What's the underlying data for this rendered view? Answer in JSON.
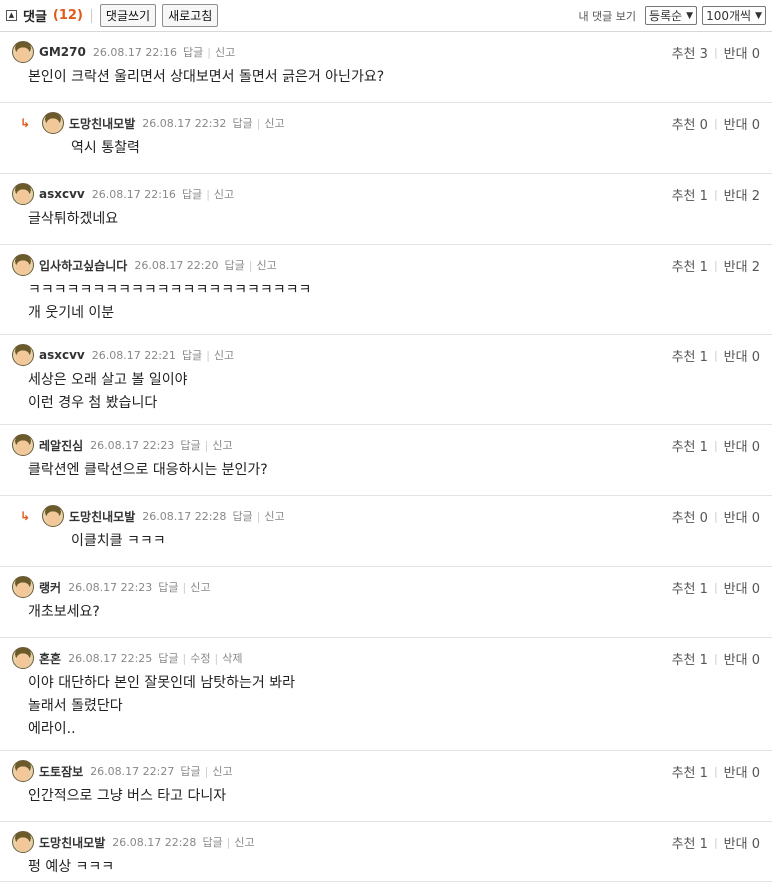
{
  "header": {
    "title": "댓글",
    "count": "(12)",
    "write_button": "댓글쓰기",
    "refresh_button": "새로고침",
    "my_comments": "내 댓글 보기",
    "sort_value": "등록순",
    "per_page_value": "100개씩"
  },
  "labels": {
    "reply": "답글",
    "report": "신고",
    "edit": "수정",
    "delete": "삭제",
    "recommend": "추천",
    "oppose": "반대",
    "reply_arrow": "↳"
  },
  "comments": [
    {
      "nick": "GM270",
      "date": "26.08.17 22:16",
      "up": "3",
      "down": "0",
      "lines": [
        "본인이 크락션 울리면서 상대보면서 돌면서 긁은거 아닌가요?"
      ]
    },
    {
      "nick": "도망친내모발",
      "date": "26.08.17 22:32",
      "up": "0",
      "down": "0",
      "lines": [
        "역시 통찰력"
      ]
    },
    {
      "nick": "asxcvv",
      "date": "26.08.17 22:16",
      "up": "1",
      "down": "2",
      "lines": [
        "글삭튀하겠네요"
      ]
    },
    {
      "nick": "입사하고싶습니다",
      "date": "26.08.17 22:20",
      "up": "1",
      "down": "2",
      "lines": [
        "ㅋㅋㅋㅋㅋㅋㅋㅋㅋㅋㅋㅋㅋㅋㅋㅋㅋㅋㅋㅋㅋㅋ",
        "개 웃기네 이분"
      ]
    },
    {
      "nick": "asxcvv",
      "date": "26.08.17 22:21",
      "up": "1",
      "down": "0",
      "lines": [
        "세상은 오래 살고 볼 일이야",
        "이런 경우 첨 봤습니다"
      ]
    },
    {
      "nick": "레알진심",
      "date": "26.08.17 22:23",
      "up": "1",
      "down": "0",
      "lines": [
        "클락션엔 클락션으로 대응하시는 분인가?"
      ]
    },
    {
      "nick": "도망친내모발",
      "date": "26.08.17 22:28",
      "up": "0",
      "down": "0",
      "lines": [
        "이클치클 ㅋㅋㅋ"
      ]
    },
    {
      "nick": "랭커",
      "date": "26.08.17 22:23",
      "up": "1",
      "down": "0",
      "lines": [
        "개초보세요?"
      ]
    },
    {
      "nick": "혼혼",
      "date": "26.08.17 22:25",
      "up": "1",
      "down": "0",
      "lines": [
        "이야 대단하다 본인 잘못인데 남탓하는거 봐라",
        "놀래서 돌렸단다",
        "에라이.."
      ]
    },
    {
      "nick": "도토잠보",
      "date": "26.08.17 22:27",
      "up": "1",
      "down": "0",
      "lines": [
        "인간적으로 그냥 버스 타고 다니자"
      ]
    },
    {
      "nick": "도망친내모발",
      "date": "26.08.17 22:28",
      "up": "1",
      "down": "0",
      "lines": [
        "펑 예상 ㅋㅋㅋ"
      ]
    }
  ]
}
